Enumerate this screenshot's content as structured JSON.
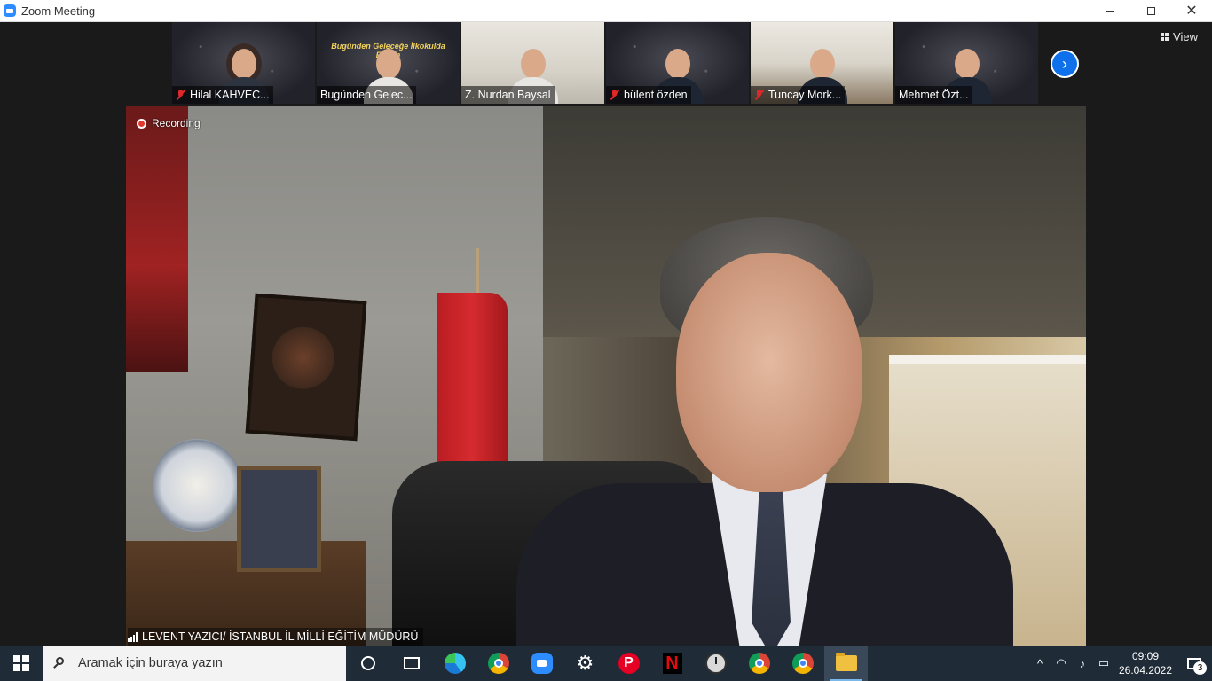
{
  "window": {
    "title": "Zoom Meeting",
    "controls": {
      "minimize": "—",
      "maximize": "❐",
      "close": "✕"
    }
  },
  "meeting": {
    "view_label": "View",
    "recording_label": "Recording",
    "banner_text": "Bugünden Geleceğe İlkokulda Eğitim",
    "participants": [
      {
        "name": "Hilal KAHVEC...",
        "muted": true
      },
      {
        "name": "Bugünden Gelec...",
        "muted": false
      },
      {
        "name": "Z. Nurdan Baysal",
        "muted": false
      },
      {
        "name": "bülent özden",
        "muted": true
      },
      {
        "name": "Tuncay Mork...",
        "muted": true
      },
      {
        "name": "Mehmet Özt...",
        "muted": false
      }
    ],
    "active_speaker": "LEVENT YAZICI/ İSTANBUL İL MİLLİ EĞİTİM MÜDÜRÜ",
    "colors": {
      "accent": "#0e71eb",
      "muted_mic": "#e02828",
      "recording": "#e33a2f"
    }
  },
  "taskbar": {
    "search_placeholder": "Aramak için buraya yazın",
    "apps": [
      "cortana-icon",
      "task-view-icon",
      "edge-icon",
      "chrome-icon",
      "zoom-icon",
      "settings-icon",
      "pinterest-icon",
      "netflix-icon",
      "clock-app-icon",
      "chrome-profile-icon",
      "chrome-profile-2-icon",
      "file-explorer-icon"
    ],
    "time": "09:09",
    "date": "26.04.2022",
    "notification_count": "3",
    "pinterest_letter": "P",
    "netflix_letter": "N"
  }
}
